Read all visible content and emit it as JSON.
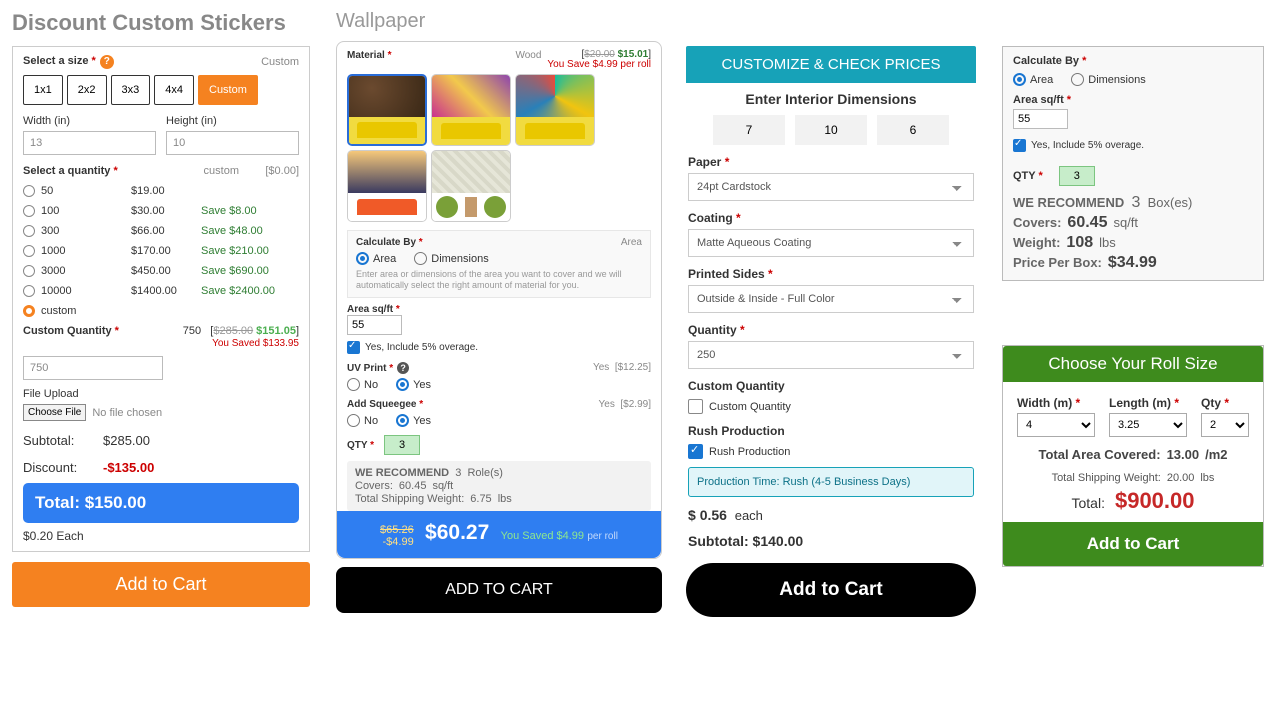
{
  "stickers": {
    "title": "Discount Custom Stickers",
    "size_label": "Select a size",
    "size_value": "Custom",
    "sizes": [
      "1x1",
      "2x2",
      "3x3",
      "4x4",
      "Custom"
    ],
    "width_label": "Width (in)",
    "width": "13",
    "height_label": "Height (in)",
    "height": "10",
    "qty_label": "Select a quantity",
    "qty_col_custom": "custom",
    "qty_col_price": "[$0.00]",
    "qty_options": [
      {
        "q": "50",
        "p": "$19.00",
        "s": ""
      },
      {
        "q": "100",
        "p": "$30.00",
        "s": "Save $8.00"
      },
      {
        "q": "300",
        "p": "$66.00",
        "s": "Save $48.00"
      },
      {
        "q": "1000",
        "p": "$170.00",
        "s": "Save $210.00"
      },
      {
        "q": "3000",
        "p": "$450.00",
        "s": "Save $690.00"
      },
      {
        "q": "10000",
        "p": "$1400.00",
        "s": "Save $2400.00"
      },
      {
        "q": "custom",
        "p": "",
        "s": ""
      }
    ],
    "custom_qty_label": "Custom Quantity",
    "custom_qty_val": "750",
    "cq_right_qty": "750",
    "cq_strike": "$285.00",
    "cq_price": "$151.05",
    "cq_saved": "You Saved $133.95",
    "file_label": "File Upload",
    "file_btn": "Choose File",
    "file_none": "No file chosen",
    "sub_label": "Subtotal:",
    "sub_val": "$285.00",
    "disc_label": "Discount:",
    "disc_val": "-$135.00",
    "total_label": "Total:",
    "total_val": "$150.00",
    "each": "$0.20  Each",
    "cart": "Add to Cart"
  },
  "wallpaper": {
    "title": "Wallpaper",
    "material_label": "Material",
    "material_value": "Wood",
    "mat_strike": "$20.00",
    "mat_price": "$15.01",
    "mat_save": "You Save $4.99 per roll",
    "calc_label": "Calculate By",
    "calc_value_label": "Area",
    "opt_area": "Area",
    "opt_dim": "Dimensions",
    "calc_help": "Enter area or dimensions of the area you want to cover and we will automatically select the right amount of material for you.",
    "area_label": "Area sq/ft",
    "area_val": "55",
    "overage": "Yes, Include 5% overage.",
    "uv_label": "UV Print",
    "uv_yes": "Yes",
    "uv_price": "[$12.25]",
    "uv_opt_no": "No",
    "uv_opt_yes": "Yes",
    "sq_label": "Add Squeegee",
    "sq_yes": "Yes",
    "sq_price": "[$2.99]",
    "qty_label": "QTY",
    "qty_val": "3",
    "rec_label": "WE RECOMMEND",
    "rec_qty": "3",
    "rec_roles": "Role(s)",
    "covers_l": "Covers:",
    "covers_v": "60.45",
    "covers_u": "sq/ft",
    "weight_l": "Total Shipping Weight:",
    "weight_v": "6.75",
    "weight_u": "lbs",
    "old": "$65.26",
    "minus": "-$4.99",
    "big": "$60.27",
    "sav": "You Saved  $4.99",
    "per": "per roll",
    "cart": "ADD TO CART"
  },
  "box": {
    "header": "CUSTOMIZE & CHECK PRICES",
    "dim_title": "Enter Interior Dimensions",
    "d1": "7",
    "d2": "10",
    "d3": "6",
    "paper_l": "Paper",
    "paper_v": "24pt Cardstock",
    "coat_l": "Coating",
    "coat_v": "Matte Aqueous Coating",
    "sides_l": "Printed Sides",
    "sides_v": "Outside & Inside - Full Color",
    "qty_l": "Quantity",
    "qty_v": "250",
    "cq_l": "Custom Quantity",
    "cq_cb": "Custom Quantity",
    "rush_l": "Rush Production",
    "rush_cb": "Rush Production",
    "prod_time": "Production Time: Rush (4-5 Business Days)",
    "each_l": "$",
    "each_v": "0.56",
    "each_u": "each",
    "sub_l": "Subtotal:",
    "sub_v": "$140.00",
    "cart": "Add to Cart"
  },
  "calc4": {
    "calc_label": "Calculate By",
    "opt_area": "Area",
    "opt_dim": "Dimensions",
    "area_label": "Area sq/ft",
    "area_val": "55",
    "overage": "Yes, Include 5% overage.",
    "qty_label": "QTY",
    "qty_val": "3",
    "rec_label": "WE RECOMMEND",
    "rec_qty": "3",
    "rec_unit": "Box(es)",
    "covers_l": "Covers:",
    "covers_v": "60.45",
    "covers_u": "sq/ft",
    "weight_l": "Weight:",
    "weight_v": "108",
    "weight_u": "lbs",
    "ppb_l": "Price Per Box:",
    "ppb_v": "$34.99"
  },
  "roll": {
    "header": "Choose Your Roll Size",
    "w_l": "Width (m)",
    "w_v": "4",
    "l_l": "Length (m)",
    "l_v": "3.25",
    "q_l": "Qty",
    "q_v": "2",
    "area_l": "Total Area Covered:",
    "area_v": "13.00",
    "area_u": "/m2",
    "ship_l": "Total Shipping Weight:",
    "ship_v": "20.00",
    "ship_u": "lbs",
    "tot_l": "Total:",
    "tot_v": "$900.00",
    "cart": "Add to Cart"
  }
}
